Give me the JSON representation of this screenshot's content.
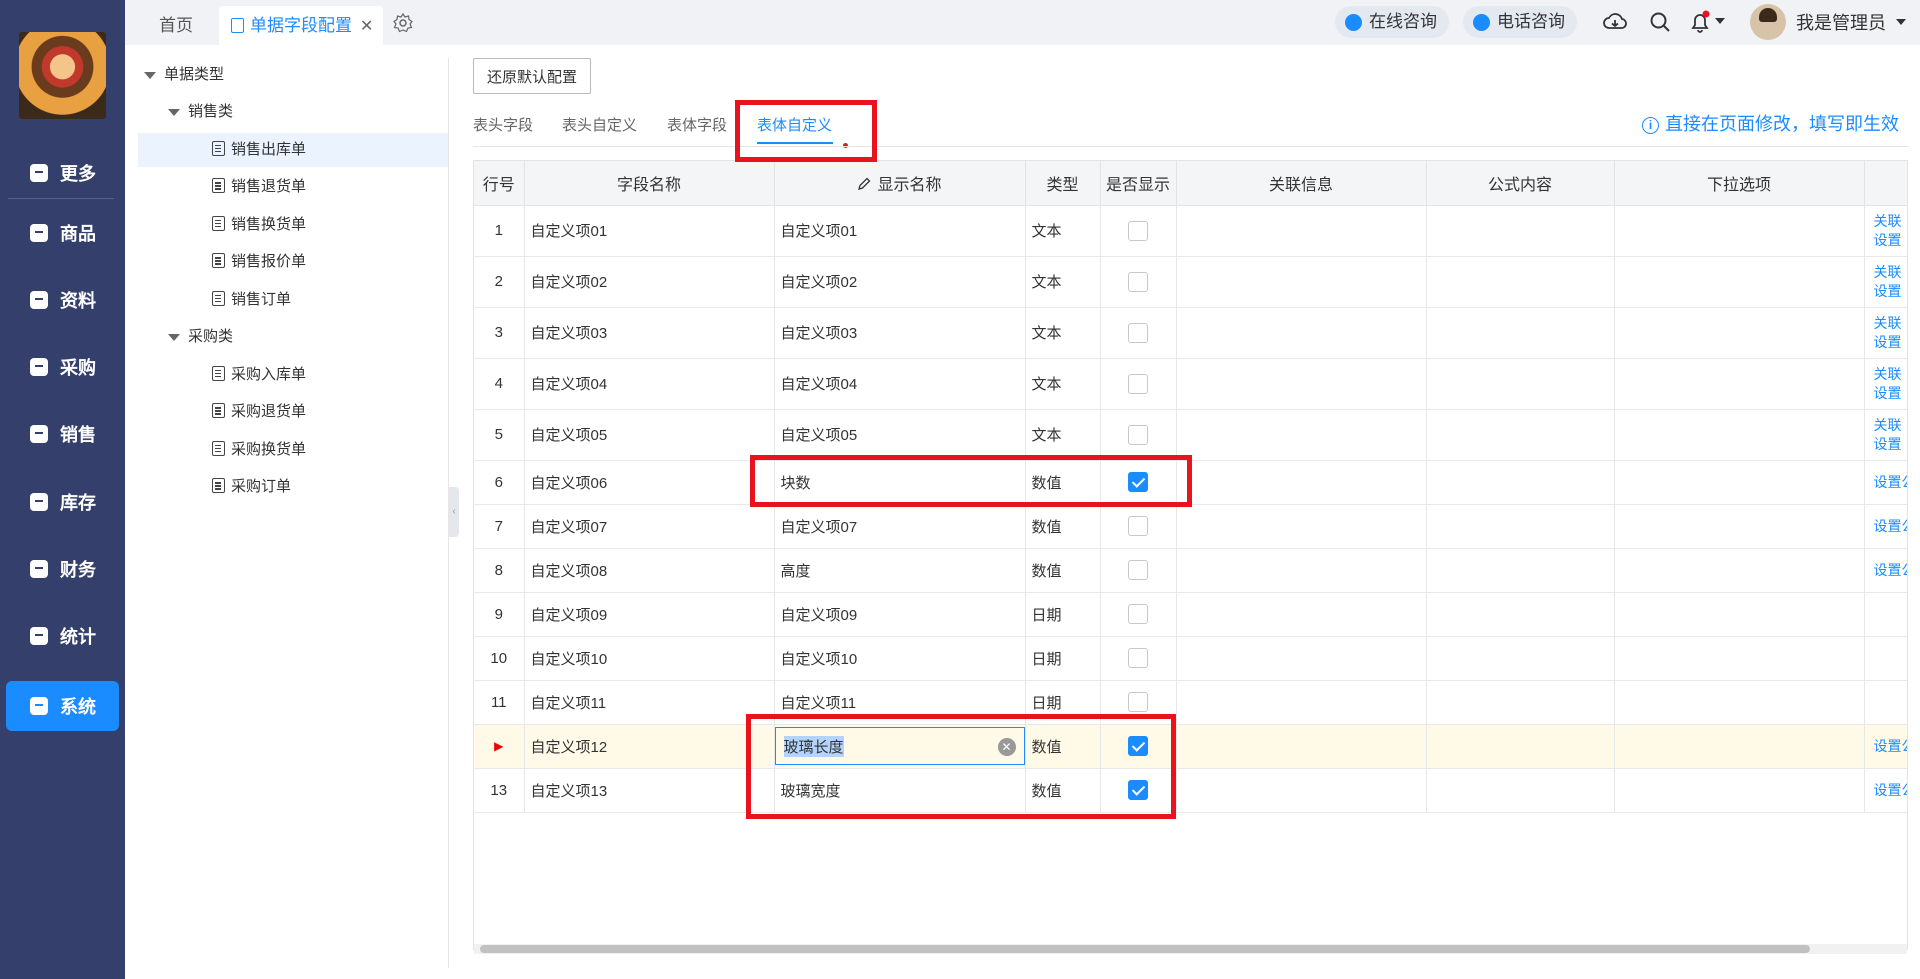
{
  "sidebar": {
    "items": [
      {
        "label": "更多",
        "icon": "plus-square-icon"
      },
      {
        "label": "商品",
        "icon": "bag-icon"
      },
      {
        "label": "资料",
        "icon": "document-icon"
      },
      {
        "label": "采购",
        "icon": "cart-icon"
      },
      {
        "label": "销售",
        "icon": "bar-chart-icon"
      },
      {
        "label": "库存",
        "icon": "warehouse-icon"
      },
      {
        "label": "财务",
        "icon": "yen-icon"
      },
      {
        "label": "统计",
        "icon": "line-chart-icon"
      },
      {
        "label": "系统",
        "icon": "hexagon-gear-icon"
      }
    ],
    "active": "系统"
  },
  "topbar": {
    "home_tab": "首页",
    "active_tab": "单据字段配置",
    "close": "✕",
    "online": "在线咨询",
    "phone": "电话咨询",
    "user_name": "我是管理员"
  },
  "tree": {
    "root": "单据类型",
    "groups": [
      {
        "label": "销售类",
        "items": [
          "销售出库单",
          "销售退货单",
          "销售换货单",
          "销售报价单",
          "销售订单"
        ]
      },
      {
        "label": "采购类",
        "items": [
          "采购入库单",
          "采购退货单",
          "采购换货单",
          "采购订单"
        ]
      }
    ],
    "selected": "销售出库单"
  },
  "main": {
    "restore_button": "还原默认配置",
    "tabs": [
      "表头字段",
      "表头自定义",
      "表体字段",
      "表体自定义"
    ],
    "active_tab": "表体自定义",
    "hint": "直接在页面修改，填写即生效"
  },
  "grid": {
    "columns": [
      "行号",
      "字段名称",
      "显示名称",
      "类型",
      "是否显示",
      "关联信息",
      "公式内容",
      "下拉选项",
      ""
    ],
    "rows": [
      {
        "idx": "1",
        "field": "自定义项01",
        "display": "自定义项01",
        "type": "文本",
        "shown": false,
        "link1": "关联",
        "link2": "设置"
      },
      {
        "idx": "2",
        "field": "自定义项02",
        "display": "自定义项02",
        "type": "文本",
        "shown": false,
        "link1": "关联",
        "link2": "设置"
      },
      {
        "idx": "3",
        "field": "自定义项03",
        "display": "自定义项03",
        "type": "文本",
        "shown": false,
        "link1": "关联",
        "link2": "设置"
      },
      {
        "idx": "4",
        "field": "自定义项04",
        "display": "自定义项04",
        "type": "文本",
        "shown": false,
        "link1": "关联",
        "link2": "设置"
      },
      {
        "idx": "5",
        "field": "自定义项05",
        "display": "自定义项05",
        "type": "文本",
        "shown": false,
        "link1": "关联",
        "link2": "设置"
      },
      {
        "idx": "6",
        "field": "自定义项06",
        "display": "块数",
        "type": "数值",
        "shown": true,
        "link1": "设置公",
        "link2": ""
      },
      {
        "idx": "7",
        "field": "自定义项07",
        "display": "自定义项07",
        "type": "数值",
        "shown": false,
        "link1": "设置公",
        "link2": ""
      },
      {
        "idx": "8",
        "field": "自定义项08",
        "display": "高度",
        "type": "数值",
        "shown": false,
        "link1": "设置公",
        "link2": ""
      },
      {
        "idx": "9",
        "field": "自定义项09",
        "display": "自定义项09",
        "type": "日期",
        "shown": false,
        "link1": "",
        "link2": ""
      },
      {
        "idx": "10",
        "field": "自定义项10",
        "display": "自定义项10",
        "type": "日期",
        "shown": false,
        "link1": "",
        "link2": ""
      },
      {
        "idx": "11",
        "field": "自定义项11",
        "display": "自定义项11",
        "type": "日期",
        "shown": false,
        "link1": "",
        "link2": ""
      },
      {
        "idx": "▶",
        "field": "自定义项12",
        "display": "玻璃长度",
        "type": "数值",
        "shown": true,
        "link1": "设置公",
        "link2": "",
        "editing": true
      },
      {
        "idx": "13",
        "field": "自定义项13",
        "display": "玻璃宽度",
        "type": "数值",
        "shown": true,
        "link1": "设置公",
        "link2": ""
      }
    ]
  },
  "colors": {
    "sidebar": "#34406b",
    "accent": "#1a8cff",
    "annotation": "#e8141d"
  }
}
